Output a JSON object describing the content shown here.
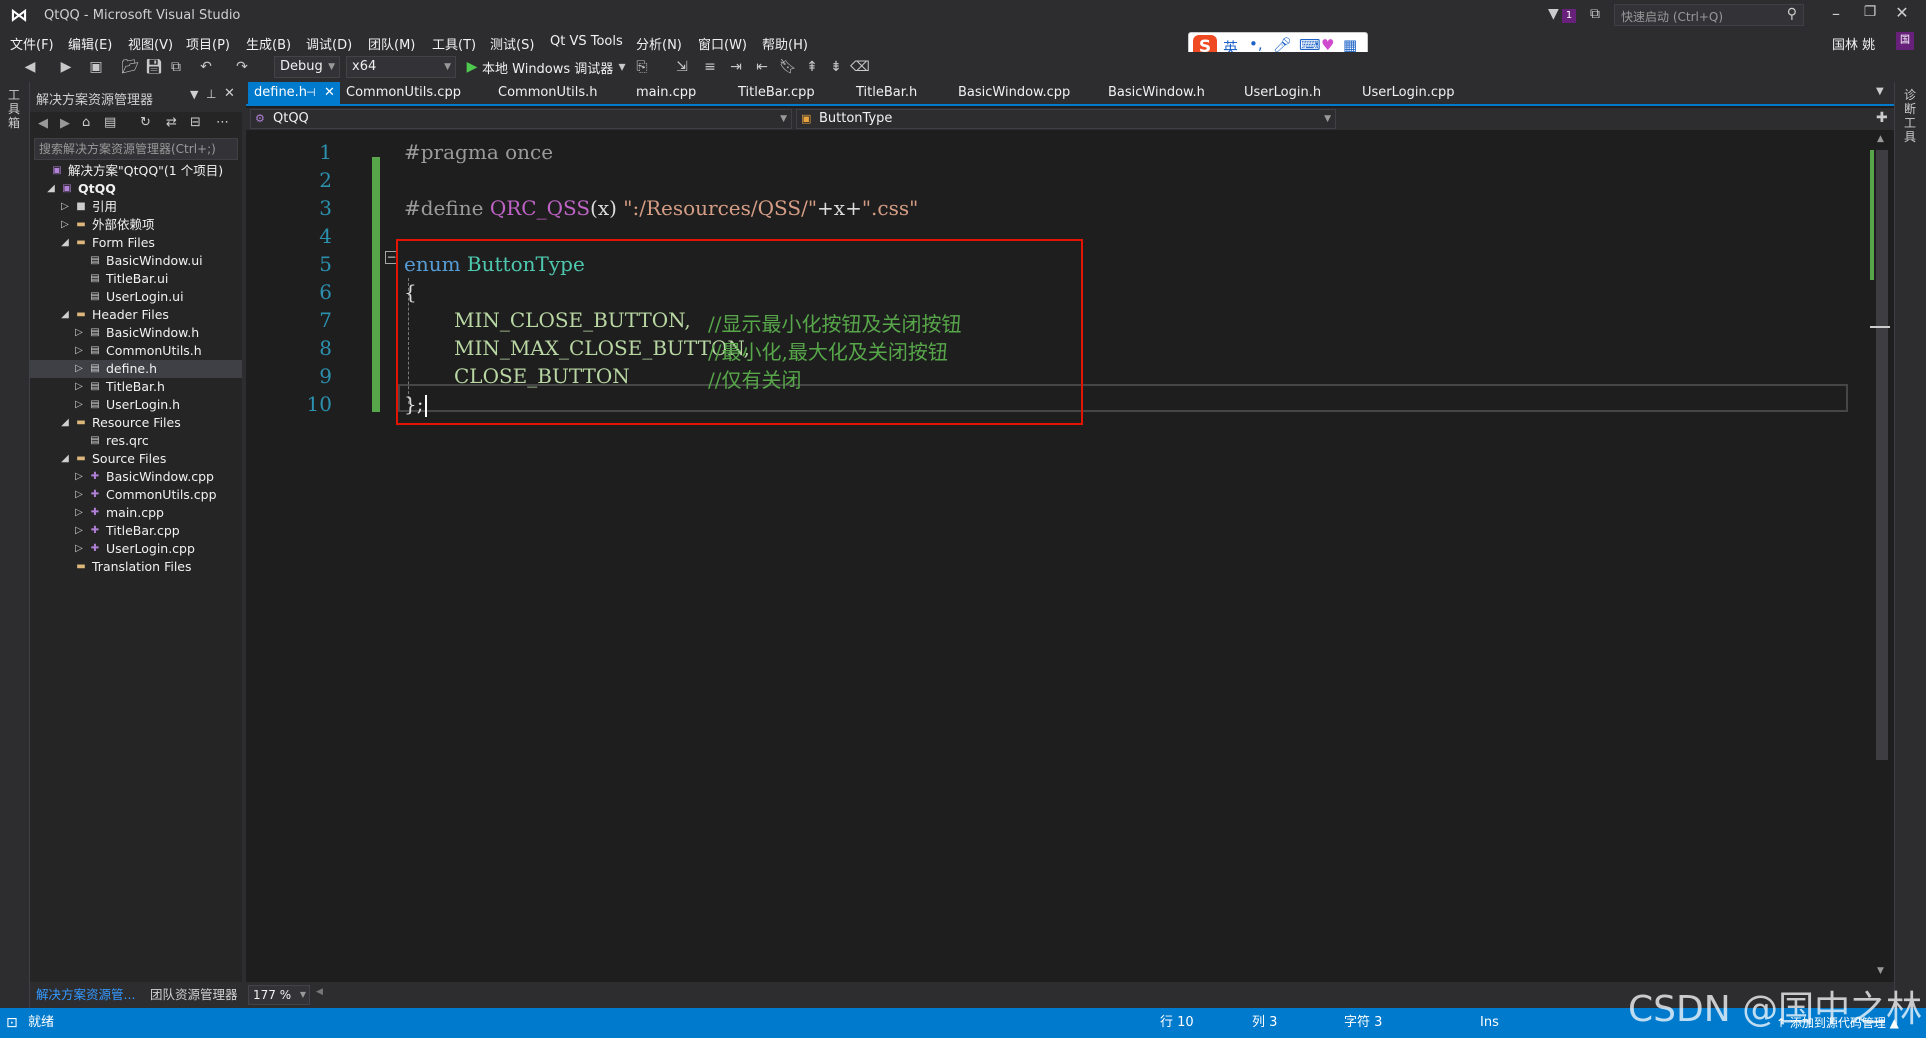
{
  "window": {
    "title": "QtQQ - Microsoft Visual Studio",
    "quick_launch": "快速启动 (Ctrl+Q)",
    "user": "国林 姚",
    "notify_count": "1"
  },
  "menu": [
    "文件(F)",
    "编辑(E)",
    "视图(V)",
    "项目(P)",
    "生成(B)",
    "调试(D)",
    "团队(M)",
    "工具(T)",
    "测试(S)",
    "Qt VS Tools",
    "分析(N)",
    "窗口(W)",
    "帮助(H)"
  ],
  "toolbar": {
    "config": "Debug",
    "platform": "x64",
    "run_label": "本地 Windows 调试器"
  },
  "ime": {
    "mode": "英"
  },
  "left_strip": {
    "label": "工具箱"
  },
  "right_strip": {
    "label": "诊断工具"
  },
  "solution": {
    "header": "解决方案资源管理器",
    "search_placeholder": "搜索解决方案资源管理器(Ctrl+;)",
    "tree": [
      {
        "label": "解决方案\"QtQQ\"(1 个项目)",
        "arrow": "",
        "icon": "solution-icon",
        "bold": false
      },
      {
        "label": "QtQQ",
        "arrow": "◢",
        "icon": "project-icon",
        "bold": true
      },
      {
        "label": "引用",
        "arrow": "▷",
        "icon": "references-icon",
        "bold": false
      },
      {
        "label": "外部依赖项",
        "arrow": "▷",
        "icon": "folder-icon",
        "bold": false
      },
      {
        "label": "Form Files",
        "arrow": "◢",
        "icon": "folder-icon",
        "bold": false
      },
      {
        "label": "BasicWindow.ui",
        "arrow": "",
        "icon": "ui-file-icon",
        "bold": false
      },
      {
        "label": "TitleBar.ui",
        "arrow": "",
        "icon": "ui-file-icon",
        "bold": false
      },
      {
        "label": "UserLogin.ui",
        "arrow": "",
        "icon": "ui-file-icon",
        "bold": false
      },
      {
        "label": "Header Files",
        "arrow": "◢",
        "icon": "folder-icon",
        "bold": false
      },
      {
        "label": "BasicWindow.h",
        "arrow": "▷",
        "icon": "header-file-icon",
        "bold": false
      },
      {
        "label": "CommonUtils.h",
        "arrow": "▷",
        "icon": "header-file-icon",
        "bold": false
      },
      {
        "label": "define.h",
        "arrow": "▷",
        "icon": "header-file-icon",
        "bold": false,
        "selected": true
      },
      {
        "label": "TitleBar.h",
        "arrow": "▷",
        "icon": "header-file-icon",
        "bold": false
      },
      {
        "label": "UserLogin.h",
        "arrow": "▷",
        "icon": "header-file-icon",
        "bold": false
      },
      {
        "label": "Resource Files",
        "arrow": "◢",
        "icon": "folder-icon",
        "bold": false
      },
      {
        "label": "res.qrc",
        "arrow": "",
        "icon": "resource-file-icon",
        "bold": false
      },
      {
        "label": "Source Files",
        "arrow": "◢",
        "icon": "folder-icon",
        "bold": false
      },
      {
        "label": "BasicWindow.cpp",
        "arrow": "▷",
        "icon": "cpp-file-icon",
        "bold": false
      },
      {
        "label": "CommonUtils.cpp",
        "arrow": "▷",
        "icon": "cpp-file-icon",
        "bold": false
      },
      {
        "label": "main.cpp",
        "arrow": "▷",
        "icon": "cpp-file-icon",
        "bold": false
      },
      {
        "label": "TitleBar.cpp",
        "arrow": "▷",
        "icon": "cpp-file-icon",
        "bold": false
      },
      {
        "label": "UserLogin.cpp",
        "arrow": "▷",
        "icon": "cpp-file-icon",
        "bold": false
      },
      {
        "label": "Translation Files",
        "arrow": "",
        "icon": "folder-icon",
        "bold": false
      }
    ],
    "footer_tabs": [
      "解决方案资源管...",
      "团队资源管理器"
    ]
  },
  "tabs": [
    "define.h",
    "CommonUtils.cpp",
    "CommonUtils.h",
    "main.cpp",
    "TitleBar.cpp",
    "TitleBar.h",
    "BasicWindow.cpp",
    "BasicWindow.h",
    "UserLogin.h",
    "UserLogin.cpp"
  ],
  "nav": {
    "project": "QtQQ",
    "symbol": "ButtonType"
  },
  "editor": {
    "line_numbers": [
      "1",
      "2",
      "3",
      "4",
      "5",
      "6",
      "7",
      "8",
      "9",
      "10"
    ],
    "code": {
      "l1": "#pragma once",
      "l3_kw": "#define ",
      "l3_macro": "QRC_QSS",
      "l3_args": "(x) ",
      "l3_str1": "\":/Resources/QSS/\"",
      "l3_plus1": "+x+",
      "l3_str2": "\".css\"",
      "l5_kw": "enum ",
      "l5_type": "ButtonType",
      "l6": "{",
      "l7_enum": "MIN_CLOSE_BUTTON,",
      "l7_cmt": "//显示最小化按钮及关闭按钮",
      "l8_enum": "MIN_MAX_CLOSE_BUTTON,",
      "l8_cmt": "//最小化,最大化及关闭按钮",
      "l9_enum": "CLOSE_BUTTON",
      "l9_cmt": "//仅有关闭",
      "l10": "};"
    },
    "zoom": "177 %"
  },
  "status": {
    "ready": "就绪",
    "line": "行 10",
    "col": "列 3",
    "char": "字符 3",
    "mode": "Ins",
    "source_control": "↑ 添加到源代码管理 ▲"
  },
  "watermark": "CSDN @国中之林"
}
